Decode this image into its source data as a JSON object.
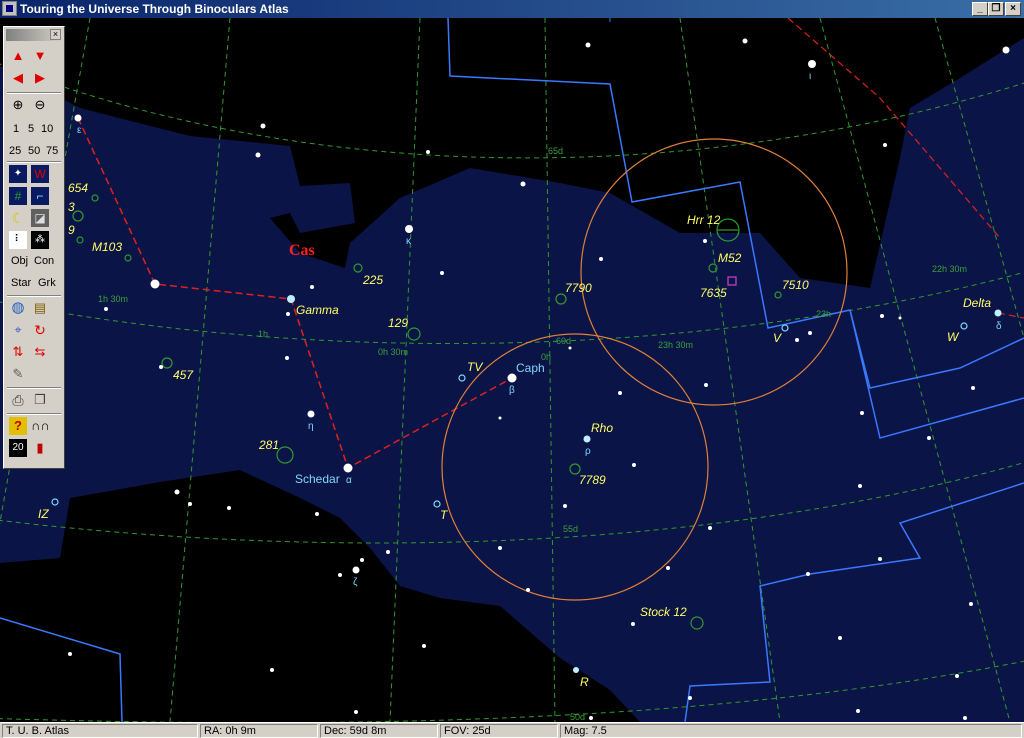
{
  "window": {
    "title": "Touring the Universe Through Binoculars Atlas"
  },
  "toolbar": {
    "zoom_levels_row1": [
      "1",
      "5",
      "10"
    ],
    "zoom_levels_row2": [
      "25",
      "50",
      "75"
    ],
    "obj_label": "Obj",
    "con_label": "Con",
    "star_label": "Star",
    "grk_label": "Grk",
    "twenty_label": "20"
  },
  "map_labels": {
    "constellation": "Cas",
    "stars": {
      "gamma": "Gamma",
      "caph": "Caph",
      "schedar": "Schedar",
      "rho": "Rho",
      "delta": "Delta",
      "tv": "TV",
      "t": "T",
      "iz": "IZ",
      "v": "V",
      "w": "W",
      "r": "R"
    },
    "objects": {
      "n654": "654",
      "n3": "3",
      "n9": "9",
      "m103": "M103",
      "n225": "225",
      "n129": "129",
      "n457": "457",
      "n281": "281",
      "n7790": "7790",
      "n7789": "7789",
      "hrr12": "Hrr 12",
      "m52": "M52",
      "n7635": "7635",
      "n7510": "7510",
      "stock12": "Stock 12"
    },
    "greek": {
      "epsilon": "ε",
      "kappa": "κ",
      "eta": "η",
      "alpha": "α",
      "beta": "β",
      "rho": "ρ",
      "zeta": "ζ",
      "delta": "δ",
      "iota": "ι"
    },
    "grid": {
      "dec65": "65d",
      "dec55": "55d",
      "dec60": "60d",
      "dec50": "50d",
      "ra1h30": "1h 30m",
      "ra1h": "1h",
      "ra0h30": "0h 30m",
      "ra0h": "0h",
      "ra23h30": "23h 30m",
      "ra23h": "23h",
      "ra22h30": "22h 30m"
    }
  },
  "statusbar": {
    "app": "T. U. B. Atlas",
    "ra": "RA: 0h 9m",
    "dec": "Dec: 59d 8m",
    "fov": "FOV: 25d",
    "mag": "Mag: 7.5"
  },
  "colors": {
    "milky_way": "#0b1446",
    "boundary": "#3a78ff",
    "stick_figure": "#e02020",
    "grid": "#2f9a2f",
    "fov_circle": "#e0803a",
    "label_yellow": "#ffff66",
    "label_cyan": "#7fd8ff"
  }
}
